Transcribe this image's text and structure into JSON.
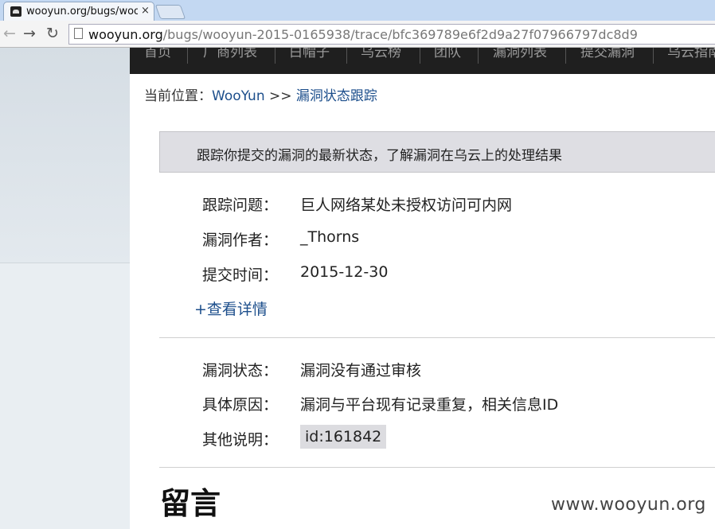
{
  "browser": {
    "tab_title": "wooyun.org/bugs/wooy",
    "tab_close": "×",
    "back": "←",
    "forward": "→",
    "reload": "↻",
    "url_host": "wooyun.org",
    "url_path": "/bugs/wooyun-2015-0165938/trace/bfc369789e6f2d9a27f07966797dc8d9"
  },
  "nav": {
    "items": [
      "首页",
      "厂商列表",
      "白帽子",
      "乌云榜",
      "团队",
      "漏洞列表",
      "提交漏洞",
      "乌云指南"
    ]
  },
  "breadcrumb": {
    "prefix": "当前位置：",
    "home": "WooYun",
    "separator": " >> ",
    "current": "漏洞状态跟踪"
  },
  "info_box": "跟踪你提交的漏洞的最新状态，了解漏洞在乌云上的处理结果",
  "details": {
    "issue_label": "跟踪问题：",
    "issue_value": "巨人网络某处未授权访问可内网",
    "author_label": "漏洞作者：",
    "author_value": "_Thorns",
    "time_label": "提交时间：",
    "time_value": "2015-12-30",
    "more_link": "+查看详情"
  },
  "status": {
    "status_label": "漏洞状态：",
    "status_value": "漏洞没有通过审核",
    "reason_label": "具体原因：",
    "reason_value": "漏洞与平台现有记录重复，相关信息ID",
    "note_label": "其他说明：",
    "note_value": "id:161842"
  },
  "comments_heading": "留言",
  "watermark": "www.wooyun.org"
}
